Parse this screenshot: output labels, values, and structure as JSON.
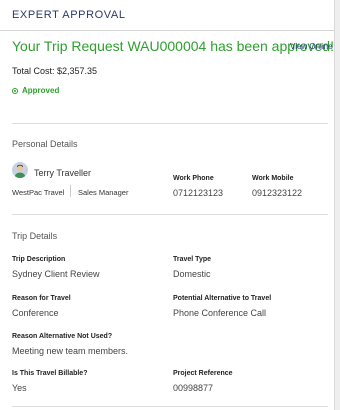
{
  "header": {
    "title": "EXPERT APPROVAL"
  },
  "approval": {
    "title": "Your Trip Request WAU000004 has been approved!",
    "view_online": "View Online",
    "total_cost": "Total Cost: $2,357.35",
    "status": "Approved",
    "status_color": "#2ea02e"
  },
  "personal": {
    "section_title": "Personal Details",
    "name": "Terry Traveller",
    "company": "WestPac Travel",
    "role": "Sales Manager",
    "work_phone_label": "Work Phone",
    "work_phone": "0712123123",
    "work_mobile_label": "Work Mobile",
    "work_mobile": "0912323122"
  },
  "trip": {
    "section_title": "Trip Details",
    "description_label": "Trip Description",
    "description": "Sydney Client Review",
    "travel_type_label": "Travel Type",
    "travel_type": "Domestic",
    "reason_label": "Reason for Travel",
    "reason": "Conference",
    "alternative_label": "Potential Alternative to Travel",
    "alternative": "Phone Conference Call",
    "alt_not_used_label": "Reason Alternative Not Used?",
    "alt_not_used": "Meeting new team members.",
    "billable_label": "Is This Travel Billable?",
    "billable": "Yes",
    "project_ref_label": "Project Reference",
    "project_ref": "00998877"
  }
}
